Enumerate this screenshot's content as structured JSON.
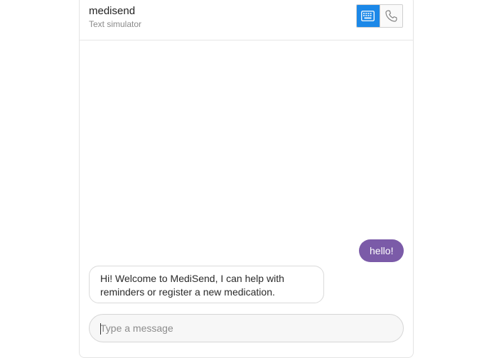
{
  "header": {
    "title": "medisend",
    "subtitle": "Text simulator",
    "modes": [
      {
        "icon": "keyboard-icon",
        "active": true
      },
      {
        "icon": "phone-icon",
        "active": false
      }
    ]
  },
  "messages": [
    {
      "direction": "outgoing",
      "text": "hello!"
    },
    {
      "direction": "incoming",
      "text": "Hi! Welcome to MediSend, I can help with reminders or register a new medication."
    }
  ],
  "composer": {
    "placeholder": "Type a message",
    "value": ""
  },
  "colors": {
    "accent": "#1b88e8",
    "outgoing_bubble": "#7b5ba8"
  }
}
